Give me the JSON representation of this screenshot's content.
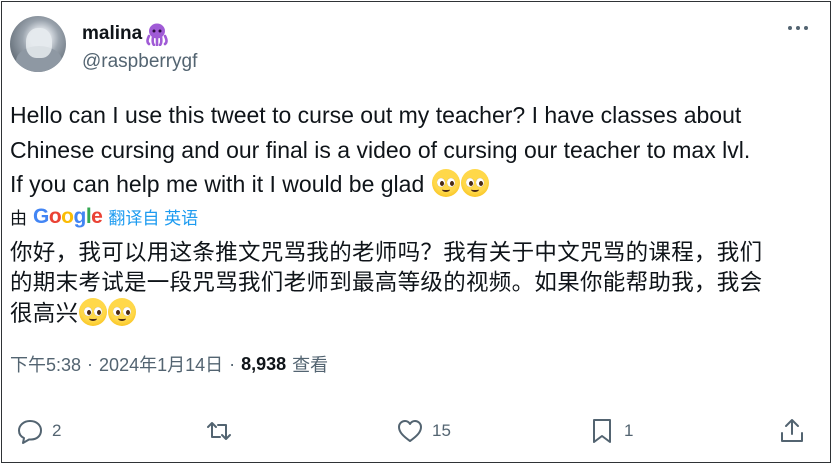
{
  "user": {
    "display_name": "malina",
    "handle": "@raspberrygf",
    "emoji_icon": "octopus-icon"
  },
  "tweet": {
    "text_line1": "Hello can I use this tweet to curse out my teacher? I have classes about",
    "text_line2": "Chinese cursing and our final is a video of cursing our teacher to max lvl.",
    "text_line3": "If you can help me with it I would be glad",
    "emoji": "pleading-face-icon"
  },
  "translation": {
    "by_label": "由",
    "provider": "Google",
    "action_label": "翻译自 英语",
    "line1": "你好，我可以用这条推文咒骂我的老师吗？我有关于中文咒骂的课程，我们",
    "line2": "的期末考试是一段咒骂我们老师到最高等级的视频。如果你能帮助我，我会",
    "line3": "很高兴"
  },
  "meta": {
    "time": "下午5:38",
    "sep1": "·",
    "date": "2024年1月14日",
    "sep2": "·",
    "views_count": "8,938",
    "views_label": "查看"
  },
  "actions": {
    "replies": "2",
    "retweets": "",
    "likes": "15",
    "bookmarks": "1"
  },
  "colors": {
    "link": "#1d9bf0",
    "secondary_text": "#536471",
    "octopus": "#a05bd6"
  }
}
